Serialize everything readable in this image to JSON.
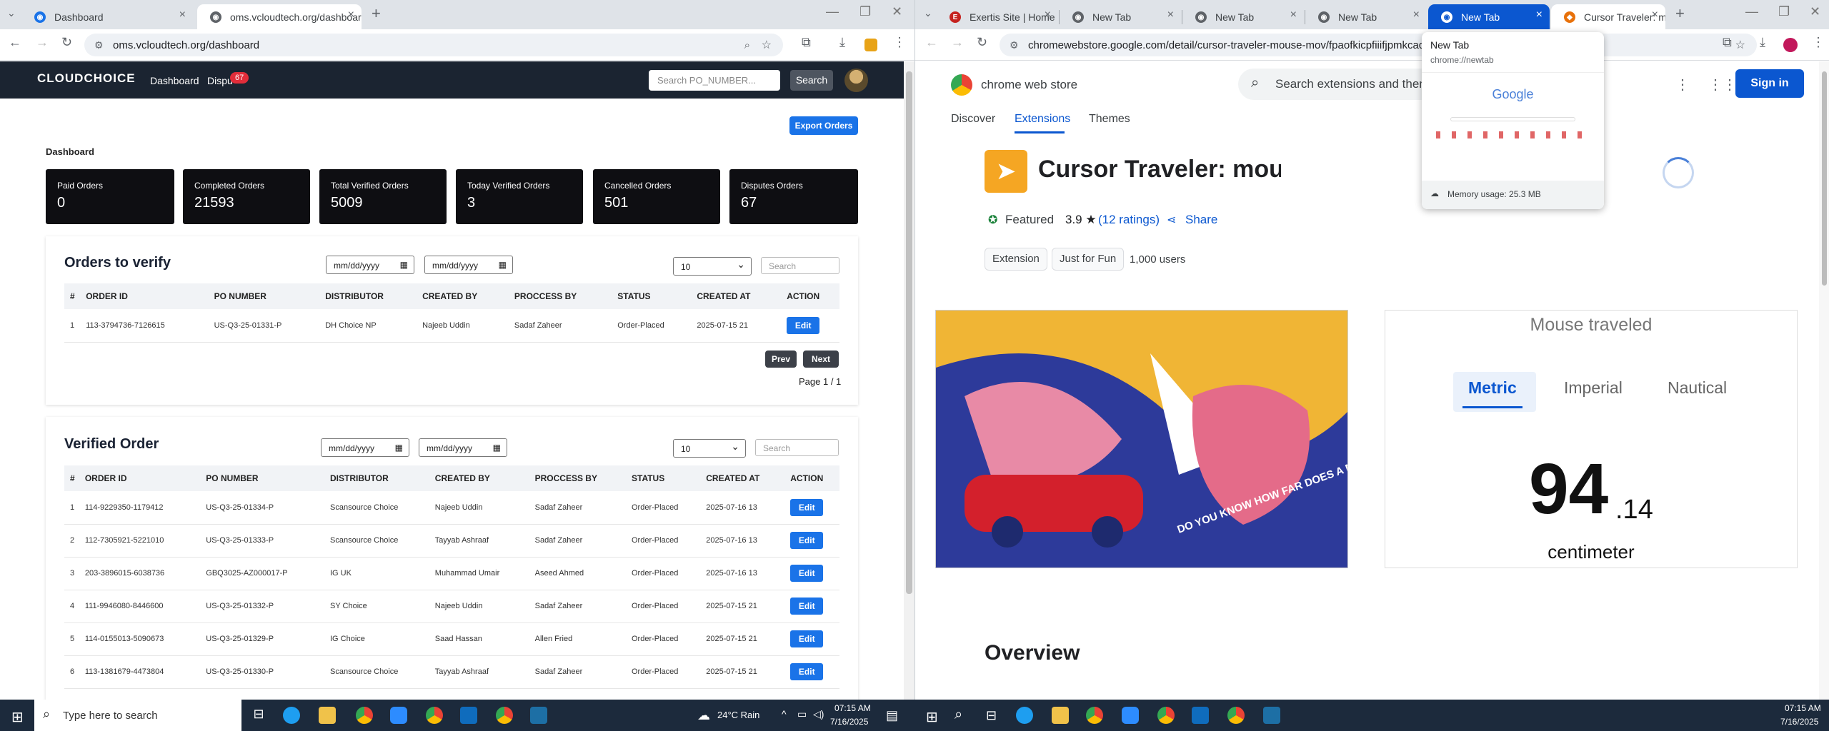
{
  "left_window": {
    "tabs": [
      {
        "label": "Dashboard"
      },
      {
        "label": "oms.vcloudtech.org/dashboard"
      }
    ],
    "url": "oms.vcloudtech.org/dashboard",
    "nav": {
      "logo": "CLOUDCHOICE",
      "links": [
        "Dashboard",
        "Dispu"
      ],
      "dispute_badge": "67",
      "search_placeholder": "Search PO_NUMBER...",
      "search_button": "Search"
    },
    "export_button": "Export Orders",
    "dashboard_title": "Dashboard",
    "stats": [
      {
        "label": "Paid Orders",
        "value": "0"
      },
      {
        "label": "Completed Orders",
        "value": "21593"
      },
      {
        "label": "Total Verified Orders",
        "value": "5009"
      },
      {
        "label": "Today Verified Orders",
        "value": "3"
      },
      {
        "label": "Cancelled Orders",
        "value": "501"
      },
      {
        "label": "Disputes Orders",
        "value": "67"
      }
    ],
    "orders_to_verify": {
      "title": "Orders to verify",
      "date_placeholder": "mm/dd/yyyy",
      "page_size": "10",
      "search_placeholder": "Search",
      "columns": [
        "#",
        "ORDER ID",
        "PO NUMBER",
        "DISTRIBUTOR",
        "CREATED BY",
        "PROCCESS BY",
        "STATUS",
        "CREATED AT",
        "ACTION"
      ],
      "rows": [
        [
          "1",
          "113-3794736-7126615",
          "US-Q3-25-01331-P",
          "DH Choice NP",
          "Najeeb Uddin",
          "Sadaf Zaheer",
          "Order-Placed",
          "2025-07-15 21",
          "Edit"
        ]
      ],
      "prev": "Prev",
      "next": "Next",
      "page_info": "Page 1 / 1"
    },
    "verified_order": {
      "title": "Verified Order",
      "date_placeholder": "mm/dd/yyyy",
      "page_size": "10",
      "search_placeholder": "Search",
      "columns": [
        "#",
        "ORDER ID",
        "PO NUMBER",
        "DISTRIBUTOR",
        "CREATED BY",
        "PROCCESS BY",
        "STATUS",
        "CREATED AT",
        "ACTION"
      ],
      "rows": [
        [
          "1",
          "114-9229350-1179412",
          "US-Q3-25-01334-P",
          "Scansource Choice",
          "Najeeb Uddin",
          "Sadaf Zaheer",
          "Order-Placed",
          "2025-07-16 13",
          "Edit"
        ],
        [
          "2",
          "112-7305921-5221010",
          "US-Q3-25-01333-P",
          "Scansource Choice",
          "Tayyab Ashraaf",
          "Sadaf Zaheer",
          "Order-Placed",
          "2025-07-16 13",
          "Edit"
        ],
        [
          "3",
          "203-3896015-6038736",
          "GBQ3025-AZ000017-P",
          "IG UK",
          "Muhammad Umair",
          "Aseed Ahmed",
          "Order-Placed",
          "2025-07-16 13",
          "Edit"
        ],
        [
          "4",
          "111-9946080-8446600",
          "US-Q3-25-01332-P",
          "SY Choice",
          "Najeeb Uddin",
          "Sadaf Zaheer",
          "Order-Placed",
          "2025-07-15 21",
          "Edit"
        ],
        [
          "5",
          "114-0155013-5090673",
          "US-Q3-25-01329-P",
          "IG Choice",
          "Saad Hassan",
          "Allen Fried",
          "Order-Placed",
          "2025-07-15 21",
          "Edit"
        ],
        [
          "6",
          "113-1381679-4473804",
          "US-Q3-25-01330-P",
          "Scansource Choice",
          "Tayyab Ashraaf",
          "Sadaf Zaheer",
          "Order-Placed",
          "2025-07-15 21",
          "Edit"
        ]
      ]
    }
  },
  "right_window": {
    "tabs": [
      {
        "label": "Exertis Site | Home"
      },
      {
        "label": "New Tab"
      },
      {
        "label": "New Tab"
      },
      {
        "label": "New Tab"
      },
      {
        "label": "New Tab"
      },
      {
        "label": "Cursor Traveler: m"
      }
    ],
    "url": "chromewebstore.google.com/detail/cursor-traveler-mouse-mov/fpaofkicpfiiifjpmkcadjpe",
    "store_name": "chrome web store",
    "search_placeholder": "Search extensions and them",
    "sign_in": "Sign in",
    "nav": [
      "Discover",
      "Extensions",
      "Themes"
    ],
    "ext_title": "Cursor Traveler: mouse move count",
    "featured": "Featured",
    "rating": "3.9 ★",
    "ratings": "(12 ratings)",
    "share": "Share",
    "chips": [
      "Extension",
      "Just for Fun"
    ],
    "users": "1,000 users",
    "promo_text": "DO YOU KNOW HOW FAR DOES A MOUSE CURSOR TRAVEL?",
    "screenshot": {
      "heading": "Mouse traveled",
      "units": [
        "Metric",
        "Imperial",
        "Nautical"
      ],
      "value_int": "94",
      "value_dec": ".14",
      "unit": "centimeter"
    },
    "overview": "Overview",
    "popup": {
      "title": "New Tab",
      "url": "chrome://newtab",
      "google": "Google",
      "memory": "Memory usage: 25.3 MB"
    }
  },
  "taskbar": {
    "search": "Type here to search",
    "weather": "24°C Rain",
    "time": "07:15 AM",
    "date": "7/16/2025"
  }
}
